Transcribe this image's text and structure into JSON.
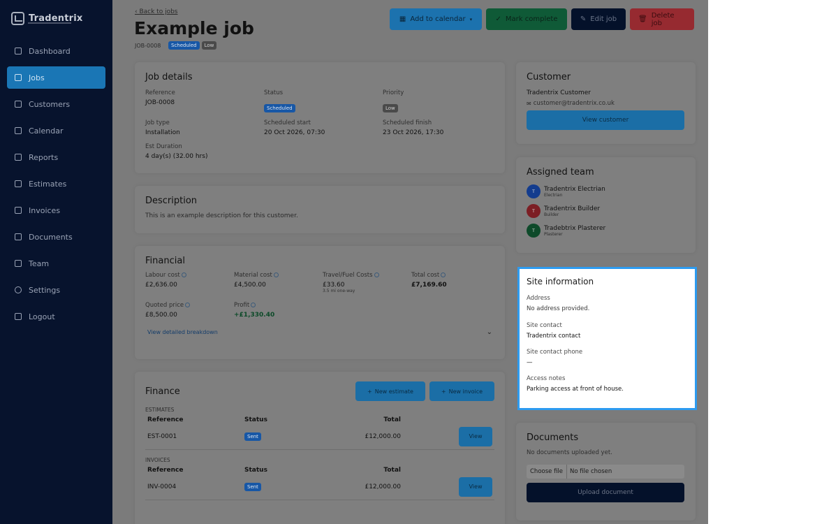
{
  "app": {
    "name": "Tradentrix"
  },
  "sidebar": {
    "items": [
      {
        "label": "Dashboard",
        "icon": "grid-icon"
      },
      {
        "label": "Jobs",
        "icon": "briefcase-icon",
        "active": true
      },
      {
        "label": "Customers",
        "icon": "users-icon"
      },
      {
        "label": "Calendar",
        "icon": "calendar-icon"
      },
      {
        "label": "Reports",
        "icon": "bar-chart-icon"
      },
      {
        "label": "Estimates",
        "icon": "file-icon"
      },
      {
        "label": "Invoices",
        "icon": "receipt-icon"
      },
      {
        "label": "Documents",
        "icon": "folder-icon"
      },
      {
        "label": "Team",
        "icon": "team-icon"
      },
      {
        "label": "Settings",
        "icon": "gear-icon"
      },
      {
        "label": "Logout",
        "icon": "logout-icon"
      }
    ]
  },
  "header": {
    "back_label": "Back to jobs",
    "title": "Example job",
    "job_id": "JOB-0008",
    "status_badge": "Scheduled",
    "priority_badge": "Low",
    "actions": {
      "calendar": "Add to calendar",
      "complete": "Mark complete",
      "edit": "Edit job",
      "delete": "Delete job"
    }
  },
  "job_details": {
    "title": "Job details",
    "fields": [
      {
        "label": "Reference",
        "value": "JOB-0008"
      },
      {
        "label": "Status",
        "value": "Scheduled"
      },
      {
        "label": "Priority",
        "value": "Low"
      },
      {
        "label": "Job type",
        "value": "Installation"
      },
      {
        "label": "Scheduled start",
        "value": "20 Oct 2026, 07:30"
      },
      {
        "label": "Scheduled finish",
        "value": "23 Oct 2026, 17:30"
      },
      {
        "label": "Est Duration",
        "value": "4 day(s) (32.00 hrs)"
      }
    ]
  },
  "description": {
    "title": "Description",
    "text": "This is an example description for this customer."
  },
  "financial": {
    "title": "Financial",
    "fields": [
      {
        "label": "Labour cost",
        "value": "£2,636.00"
      },
      {
        "label": "Material cost",
        "value": "£4,500.00"
      },
      {
        "label": "Travel/Fuel Costs",
        "value": "£33.60",
        "note": "3.5 mi one-way"
      },
      {
        "label": "Total cost",
        "value": "£7,169.60"
      },
      {
        "label": "Quoted price",
        "value": "£8,500.00"
      },
      {
        "label": "Profit",
        "value": "+£1,330.40"
      }
    ],
    "breakdown_link": "View detailed breakdown"
  },
  "finance": {
    "title": "Finance",
    "new_estimate": "New estimate",
    "new_invoice": "New invoice",
    "estimates_label": "ESTIMATES",
    "invoices_label": "INVOICES",
    "columns": [
      "Reference",
      "Status",
      "Total"
    ],
    "estimates": [
      {
        "reference": "EST-0001",
        "status": "Sent",
        "total": "£12,000.00",
        "action": "View"
      }
    ],
    "invoices": [
      {
        "reference": "INV-0004",
        "status": "Sent",
        "total": "£12,000.00",
        "action": "View"
      }
    ]
  },
  "customer": {
    "title": "Customer",
    "name": "Tradentrix Customer",
    "email": "customer@tradentrix.co.uk",
    "button": "View customer"
  },
  "team": {
    "title": "Assigned team",
    "members": [
      {
        "initial": "T",
        "name": "Tradentrix Electrian",
        "role": "Electrian",
        "color": "#133c8e"
      },
      {
        "initial": "T",
        "name": "Tradentrix Builder",
        "role": "Builder",
        "color": "#7c1e24"
      },
      {
        "initial": "T",
        "name": "Tradebtrix Plasterer",
        "role": "Plasterer",
        "color": "#0e4a2a"
      }
    ]
  },
  "site": {
    "title": "Site information",
    "address_label": "Address",
    "address_value": "No address provided.",
    "contact_label": "Site contact",
    "contact_value": "Tradentrix contact",
    "phone_label": "Site contact phone",
    "phone_value": "—",
    "notes_label": "Access notes",
    "notes_value": "Parking access at front of house."
  },
  "documents": {
    "title": "Documents",
    "empty_text": "No documents uploaded yet.",
    "choose_file": "Choose file",
    "no_file": "No file chosen",
    "upload_button": "Upload document"
  },
  "colors": {
    "sidebar_bg": "#07132d",
    "active_nav": "#1a76b5",
    "overlay_bg": "#7b7b7b",
    "highlight_border": "#2d9bf0"
  }
}
